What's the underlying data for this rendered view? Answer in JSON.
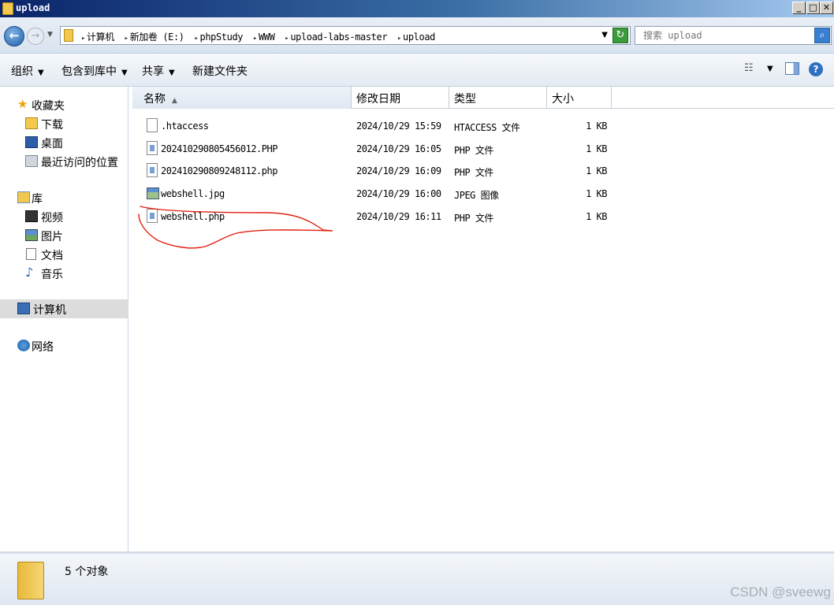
{
  "window": {
    "title": "upload"
  },
  "address": {
    "crumbs": [
      "计算机",
      "新加卷 (E:)",
      "phpStudy",
      "WWW",
      "upload-labs-master",
      "upload"
    ]
  },
  "search": {
    "placeholder": "搜索 upload"
  },
  "toolbar": {
    "organize": "组织",
    "include_library": "包含到库中",
    "share": "共享",
    "new_folder": "新建文件夹"
  },
  "sidebar": {
    "favorites": "收藏夹",
    "downloads": "下载",
    "desktop": "桌面",
    "recent": "最近访问的位置",
    "libraries": "库",
    "videos": "视频",
    "pictures": "图片",
    "documents": "文档",
    "music": "音乐",
    "computer": "计算机",
    "network": "网络"
  },
  "columns": {
    "name": "名称",
    "date": "修改日期",
    "type": "类型",
    "size": "大小"
  },
  "files": [
    {
      "name": ".htaccess",
      "date": "2024/10/29 15:59",
      "type": "HTACCESS 文件",
      "size": "1 KB",
      "icon": "blank-file-icon"
    },
    {
      "name": "202410290805456012.PHP",
      "date": "2024/10/29 16:05",
      "type": "PHP 文件",
      "size": "1 KB",
      "icon": "php-file-icon"
    },
    {
      "name": "202410290809248112.php",
      "date": "2024/10/29 16:09",
      "type": "PHP 文件",
      "size": "1 KB",
      "icon": "php-file-icon"
    },
    {
      "name": "webshell.jpg",
      "date": "2024/10/29 16:00",
      "type": "JPEG 图像",
      "size": "1 KB",
      "icon": "image-file-icon"
    },
    {
      "name": "webshell.php",
      "date": "2024/10/29 16:11",
      "type": "PHP 文件",
      "size": "1 KB",
      "icon": "php-file-icon"
    }
  ],
  "status": {
    "count": "5 个对象"
  },
  "watermark": "CSDN @sveewg",
  "colors": {
    "annotation": "#e02010",
    "selection": "#dcdcdc"
  }
}
